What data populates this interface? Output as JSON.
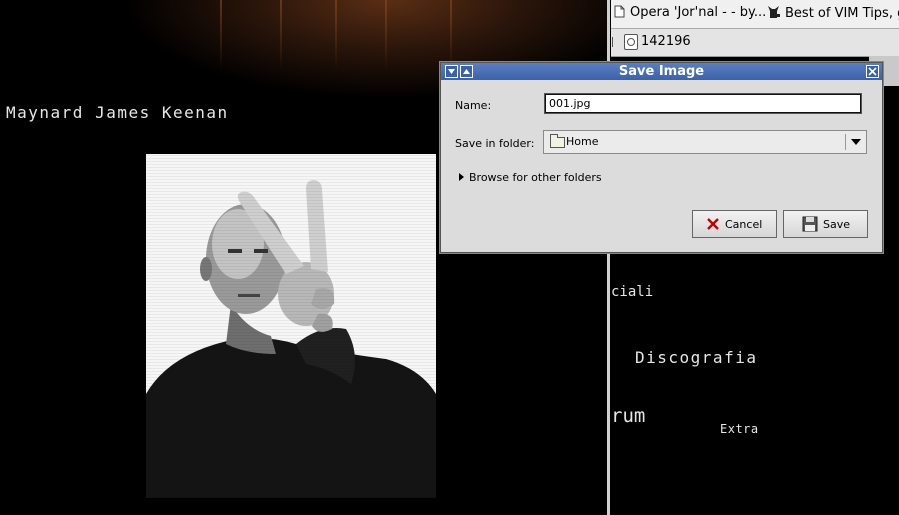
{
  "left_page": {
    "artist_name": "Maynard James Keenan"
  },
  "browser": {
    "tabs": [
      {
        "label": "Opera 'Jor'nal - - by...",
        "icon": "document-icon"
      },
      {
        "label": "Best of VIM Tips, g",
        "icon": "cat-icon"
      }
    ],
    "address_value": "142196",
    "page_links": {
      "sociali": "ciali",
      "discografia": "Discografia",
      "forum": "rum",
      "extra": "Extra"
    }
  },
  "dialog": {
    "title": "Save Image",
    "name_label": "Name:",
    "name_value": "001.jpg",
    "folder_label": "Save in folder:",
    "folder_value": "Home",
    "browse_label": "Browse for other folders",
    "cancel_label": "Cancel",
    "save_label": "Save"
  },
  "colors": {
    "titlebar": "#3b61a8",
    "dialog_bg": "#dcdcdc",
    "cancel_x": "#c00000"
  }
}
